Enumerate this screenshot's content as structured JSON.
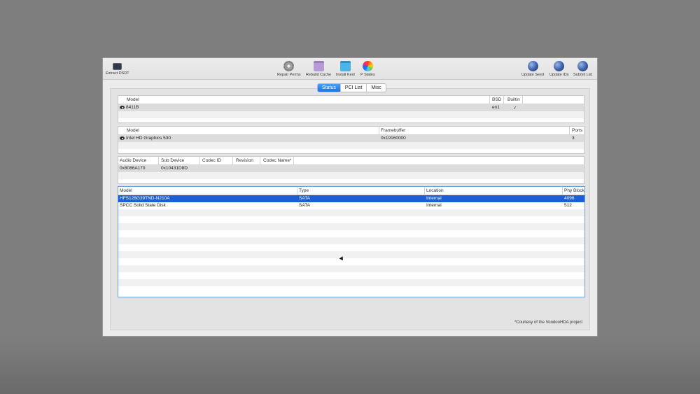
{
  "toolbar": {
    "extract_dsdt": "Extract DSDT",
    "repair_perms": "Repair Perms",
    "rebuild_cache": "Rebuild Cache",
    "install_kext": "Install Kext",
    "p_states": "P States",
    "update_seed": "Update Seed",
    "update_ids": "Update IDs",
    "submit_list": "Submit List"
  },
  "tabs": [
    "Status",
    "PCI List",
    "Misc"
  ],
  "network": {
    "headers": [
      "Model",
      "BSD",
      "Builtin"
    ],
    "rows": [
      [
        "8411B",
        "en1",
        "✓"
      ]
    ]
  },
  "graphics": {
    "headers": [
      "Model",
      "Framebuffer",
      "Ports"
    ],
    "rows": [
      [
        "Intel HD Graphics 530",
        "0x19160000",
        "3"
      ]
    ]
  },
  "audio": {
    "headers": [
      "Audio Device",
      "Sub Device",
      "Codec ID",
      "Revision",
      "Codec Name*"
    ],
    "rows": [
      [
        "0x8086A170",
        "0x10431D8D",
        "",
        "",
        ""
      ]
    ]
  },
  "disks": {
    "headers": [
      "Model",
      "Type",
      "Location",
      "Phy Block"
    ],
    "rows": [
      [
        "HFS128G39TND-N210A",
        "SATA",
        "Internal",
        "4096"
      ],
      [
        "SPCC Solid State Disk",
        "SATA",
        "Internal",
        "512"
      ]
    ]
  },
  "footnote": "*Courtesy of the VoodooHDA project"
}
